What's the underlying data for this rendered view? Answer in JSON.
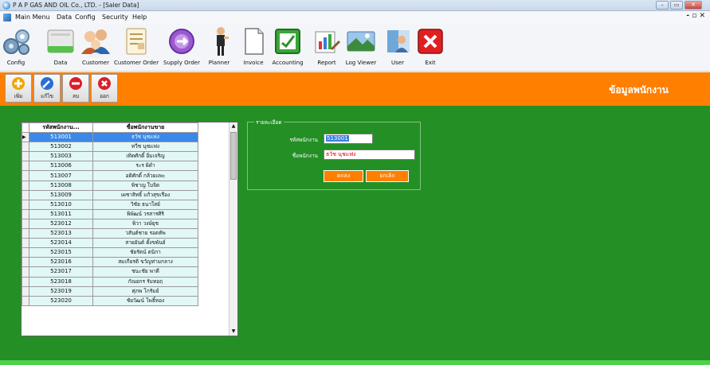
{
  "window": {
    "title": "P A P GAS AND OIL Co., LTD. - [Saler Data]",
    "minimize": "–",
    "maximize": "▭",
    "close": "✕"
  },
  "menu": {
    "items": [
      "Main Menu",
      "Data",
      "Config",
      "Security",
      "Help"
    ],
    "mdi_controls": "- ▫ ✕"
  },
  "toolbar": {
    "buttons": [
      {
        "label": "Config",
        "icon": "gears-icon"
      },
      {
        "label": "Data",
        "icon": "server-icon"
      },
      {
        "label": "Customer",
        "icon": "customers-icon"
      },
      {
        "label": "Customer Order",
        "icon": "customer-order-icon"
      },
      {
        "label": "Supply Order",
        "icon": "supply-order-icon"
      },
      {
        "label": "Planner",
        "icon": "planner-icon"
      },
      {
        "label": "Invoice",
        "icon": "invoice-icon"
      },
      {
        "label": "Accounting",
        "icon": "accounting-icon"
      },
      {
        "label": "Report",
        "icon": "report-icon"
      },
      {
        "label": "Log Viewer",
        "icon": "log-viewer-icon"
      },
      {
        "label": "User",
        "icon": "user-icon"
      },
      {
        "label": "Exit",
        "icon": "exit-icon"
      }
    ]
  },
  "actions": {
    "buttons": [
      {
        "label": "เพิ่ม",
        "icon": "add-icon",
        "color": "#f2a500"
      },
      {
        "label": "แก้ไข",
        "icon": "edit-icon",
        "color": "#2a6fd6"
      },
      {
        "label": "ลบ",
        "icon": "delete-icon",
        "color": "#d8202a"
      },
      {
        "label": "ออก",
        "icon": "close-icon",
        "color": "#d8202a"
      }
    ],
    "page_title": "ข้อมูลพนักงาน"
  },
  "colors": {
    "accent": "#ff7f00",
    "main_bg": "#248f24",
    "selection": "#3b88e8",
    "cell_bg": "#e2f7f7",
    "error_text": "#e00000"
  },
  "grid": {
    "columns": [
      "รหัสพนักงาน...",
      "ชื่อพนักงานขาย"
    ],
    "selected_index": 0,
    "rows": [
      {
        "id": "513001",
        "name": "ธวัช นุชแฟง"
      },
      {
        "id": "513002",
        "name": "ทวีช นุชแฟง"
      },
      {
        "id": "513003",
        "name": "เทิดศักดิ์ อิ่มเจริญ"
      },
      {
        "id": "513006",
        "name": "ระร ผิดำ"
      },
      {
        "id": "513007",
        "name": "อดิศักดิ์ กล้วยแพะ"
      },
      {
        "id": "513008",
        "name": "พิชาญ ใบจิต"
      },
      {
        "id": "513009",
        "name": "เผชาสิทธิ์ แก้วสุขเรือง"
      },
      {
        "id": "513010",
        "name": "วิชัย ธนาใสย์"
      },
      {
        "id": "513011",
        "name": "พิพัฒน์ วรสารศิริ"
      },
      {
        "id": "523012",
        "name": "พิวา วงษ์ยุช"
      },
      {
        "id": "523013",
        "name": "วสันต์ชาย รอดทัพ"
      },
      {
        "id": "523014",
        "name": "สายยันต์ ตั้งขพันธ์"
      },
      {
        "id": "523015",
        "name": "ชัยรัตน์ ตนิกา"
      },
      {
        "id": "523016",
        "name": "สมเกียรติ ขวัญท่ามกลาง"
      },
      {
        "id": "523017",
        "name": "ชนะชัย พาดี"
      },
      {
        "id": "523018",
        "name": "กัณยกร รัมทอฤ"
      },
      {
        "id": "523019",
        "name": "ศุภพ โกรัมย์"
      },
      {
        "id": "523020",
        "name": "ชัยวัฒน์ โพธิ์ทอง"
      }
    ]
  },
  "details": {
    "legend": "รายละเอียด",
    "id_label": "รหัสพนักงาน",
    "id_value": "513001",
    "name_label": "ชื่อพนักงาน",
    "name_value": "ธวัช นุชแฟง",
    "ok_label": "ตกลง",
    "cancel_label": "ยกเลิก"
  }
}
